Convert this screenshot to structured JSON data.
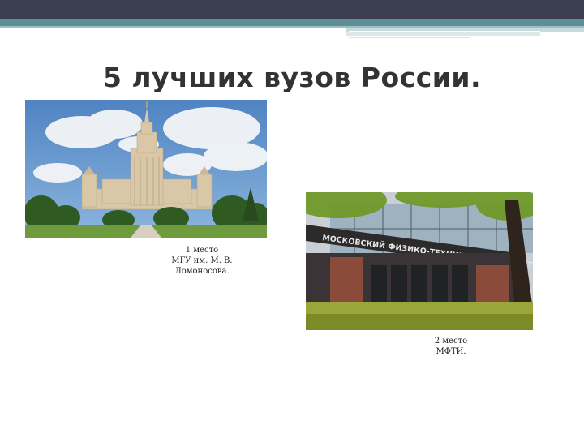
{
  "slide": {
    "title": "5 лучших вузов России."
  },
  "photos": [
    {
      "subject": "MSU main building",
      "caption": [
        "1 место",
        "МГУ им. М. В.",
        "Ломоносова."
      ]
    },
    {
      "subject": "MIPT building",
      "sign_text": "МОСКОВСКИЙ ФИЗИКО-ТЕХНИЧЕСКИЙ ИНСТИТУТ",
      "caption": [
        "2 место",
        "МФТИ."
      ]
    }
  ],
  "colors": {
    "header_dark": "#3b3f4f",
    "header_teal": "#5c8f96",
    "title_text": "#333333"
  }
}
